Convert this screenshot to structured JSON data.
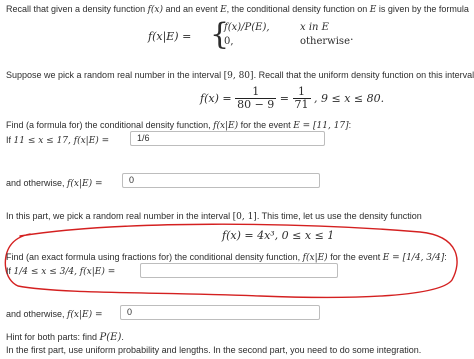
{
  "intro": {
    "text_a": "Recall that given a density function ",
    "f_x": "f(x)",
    "text_b": " and an event ",
    "e1": "E",
    "text_c": ", the conditional density function on ",
    "e2": "E",
    "text_d": " is given by the formula"
  },
  "formula1": {
    "lhs": "f(x|E) =",
    "case1_expr": "f(x)/P(E),",
    "case1_cond": "x in E",
    "case2_expr": "0,",
    "case2_cond": "otherwise",
    "end": "."
  },
  "part1": {
    "intro_a": "Suppose we pick a random real number in the interval ",
    "interval": "[9, 80]",
    "intro_b": ". Recall that the uniform density function on this interval is",
    "f_lhs": "f(x) =",
    "frac1_num": "1",
    "frac1_den": "80 − 9",
    "eq": "=",
    "frac2_num": "1",
    "frac2_den": "71",
    "f_cond": ", 9 ≤ x ≤ 80.",
    "find_a": "Find (a formula for) the conditional density function, ",
    "find_fxe": "f(x|E)",
    "find_b": " for the event ",
    "event": "E = [11, 17]",
    "find_c": ":",
    "if_prefix": "If ",
    "if_cond": "11 ≤ x ≤ 17, f(x|E) =",
    "answer1": "1/6",
    "otherwise_a": "and otherwise, ",
    "otherwise_f": "f(x|E) =",
    "answer2": "0"
  },
  "part2": {
    "intro_a": "In this part, we pick a random real number in the interval ",
    "interval": "[0, 1]",
    "intro_b": ". This time, let us use the density function",
    "f_expr": "f(x) = 4x³, 0 ≤ x ≤ 1",
    "find_a": "Find (an exact formula using fractions for) the conditional density function, ",
    "find_fxe": "f(x|E)",
    "find_b": " for the event ",
    "event": "E = [1/4, 3/4]",
    "find_c": ":",
    "if_prefix": "If ",
    "if_cond": "1/4 ≤ x ≤ 3/4, f(x|E) =",
    "answer3": "",
    "otherwise_a": "and otherwise, ",
    "otherwise_f": "f(x|E) =",
    "answer4": "0"
  },
  "hint": {
    "line1_a": "Hint for both parts: find ",
    "line1_pe": "P(E)",
    "line1_b": ".",
    "line2": "In the first part, use uniform probability and lengths. In the second part, you need to do some integration."
  },
  "colors": {
    "annotation": "#d42020",
    "input_border": "#bdbdbd",
    "text": "#2d2d2d"
  }
}
